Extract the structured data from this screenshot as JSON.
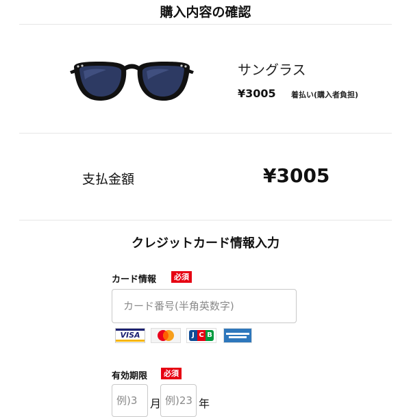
{
  "page": {
    "title": "購入内容の確認"
  },
  "product": {
    "name": "サングラス",
    "price": "¥3005",
    "shipping": "着払い(購入者負担)",
    "image_icon": "sunglasses-icon"
  },
  "payment": {
    "label": "支払金額",
    "amount": "¥3005"
  },
  "card_section": {
    "title": "クレジットカード情報入力",
    "card_info": {
      "label": "カード情報",
      "required": "必須",
      "placeholder": "カード番号(半角英数字)",
      "value": ""
    },
    "brands": {
      "visa": "VISA",
      "jcb": "JCB",
      "mastercard_icon": "mastercard-logo",
      "amex_icon": "american-express-logo"
    },
    "expiry": {
      "label": "有効期限",
      "required": "必須",
      "month_placeholder": "例)3",
      "month_unit": "月",
      "year_placeholder": "例)23",
      "year_unit": "年"
    }
  },
  "colors": {
    "required_badge": "#e60012",
    "visa_blue": "#1a1f71",
    "amex_blue": "#2e77bc",
    "jcb_blue": "#0e4c96"
  }
}
